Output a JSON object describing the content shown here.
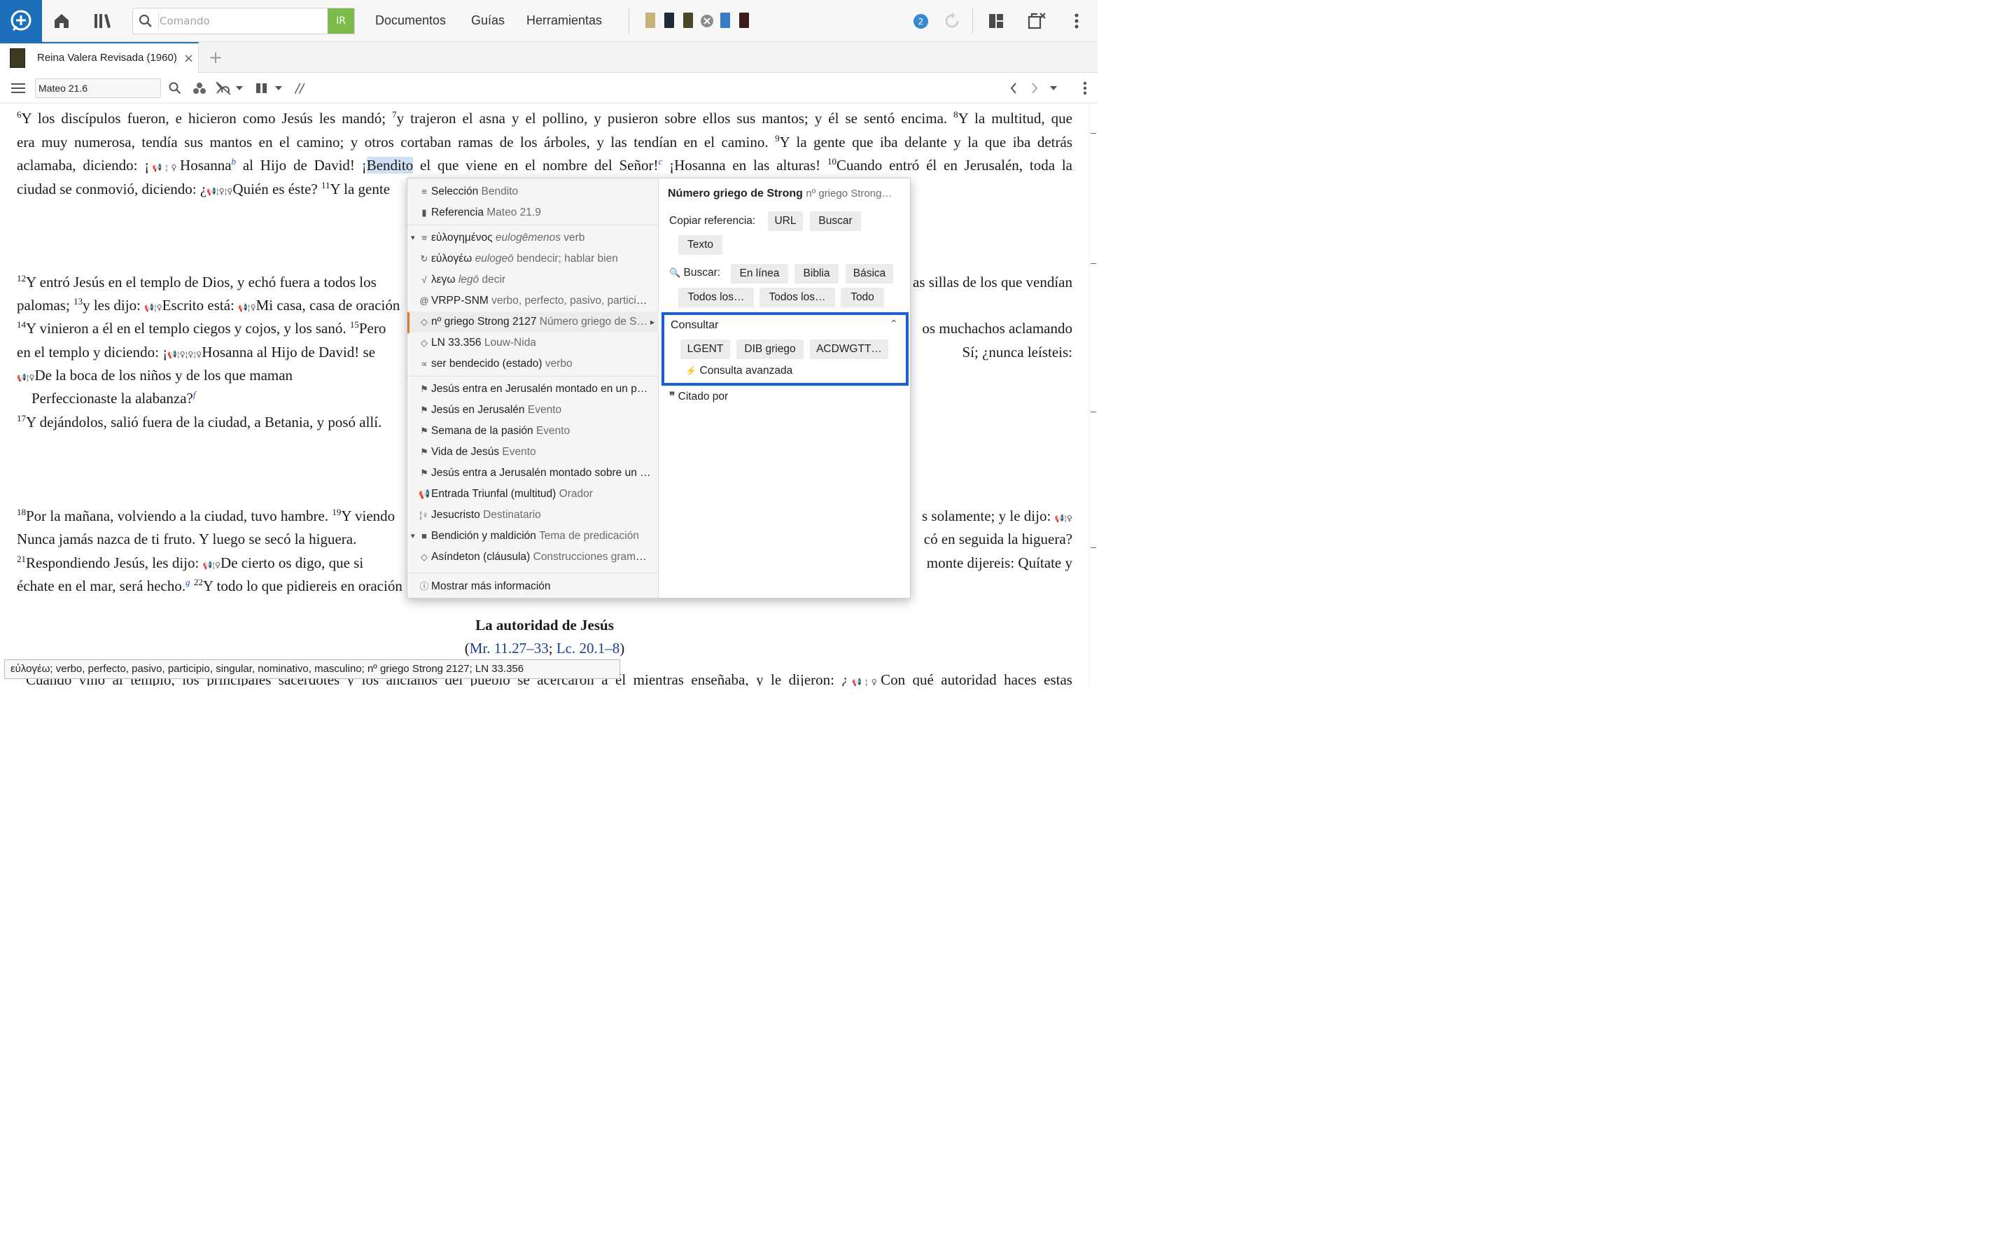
{
  "toolbar": {
    "command_placeholder": "Comando",
    "go_label": "IR",
    "nav": [
      "Documentos",
      "Guías",
      "Herramientas"
    ],
    "notifications": "2"
  },
  "tab": {
    "title": "Reina Valera Revisada (1960)",
    "close": "×",
    "add": "+"
  },
  "panel": {
    "reference": "Mateo 21.6",
    "parallel": "//"
  },
  "text": {
    "lines": [
      {
        "html": "<sup>6</sup>Y los discípulos fueron, e hicieron como Jesús les mandó; <sup>7</sup>y trajeron el asna y el pollino, y pusieron sobre ellos sus mantos; y él se sentó encima. <sup>8</sup>Y la multitud, que"
      },
      {
        "html": "era muy numerosa, tendía sus mantos en el camino; y otros cortaban ramas de los árboles, y las tendían en el camino. <sup>9</sup>Y la gente que iba delante y la que iba detrás"
      },
      {
        "html": "aclamaba, diciendo: ¡<span class=\"sp\">📢¦♀</span>Hosanna<sup class=\"fn\">b</sup> al Hijo de David! ¡<span class=\"hl\">Bendito</span> el que viene en el nombre del Señor!<sup class=\"fn\">c</sup> ¡Hosanna en las alturas! <sup>10</sup>Cuando entró él en Jerusalén, toda la"
      },
      {
        "html": "ciudad se conmovió, diciendo: ¿<span class=\"sp\">📢¦♀¦♀</span>Quién es éste? <sup>11</sup>Y la gente",
        "left": true
      },
      {
        "html": "<sup>12</sup>Y entró Jesús en el templo de Dios, y echó fuera a todos los",
        "right": "as sillas de los que vendían"
      },
      {
        "html": "palomas; <sup>13</sup>y les dijo: <span class=\"sp\">📢¦♀</span>Escrito está: <span class=\"sp\">📢¦♀</span>Mi casa, casa de oración",
        "left": true
      },
      {
        "html": " <sup>14</sup>Y vinieron a él en el templo ciegos y cojos, y los sanó. <sup>15</sup>Pero",
        "right": "os muchachos aclamando"
      },
      {
        "html": "en el templo y diciendo: ¡<span class=\"sp\">📢¦♀¦♀¦♀</span>Hosanna al Hijo de David! se",
        "right": "Sí; ¿nunca leísteis:"
      },
      {
        "html": "<span class=\"sp\">📢¦♀</span>De la boca de los niños y de los que maman",
        "left": true
      },
      {
        "html": "&nbsp;&nbsp;&nbsp;&nbsp;Perfeccionaste la alabanza?<sup class=\"fn\">f</sup>",
        "left": true
      },
      {
        "html": "<sup>17</sup>Y dejándolos, salió fuera de la ciudad, a Betania, y posó allí.",
        "left": true
      },
      {
        "html": " <sup>18</sup>Por la mañana, volviendo a la ciudad, tuvo hambre. <sup>19</sup>Y viendo",
        "right": "s solamente; y le dijo: <span class=\"sp\">📢¦♀</span>"
      },
      {
        "html": "Nunca jamás nazca de ti fruto. Y luego se secó la higuera.",
        "right": "có en seguida la higuera?"
      },
      {
        "html": "<sup>21</sup>Respondiendo Jesús, les dijo: <span class=\"sp\">📢¦♀</span>De cierto os digo, que si",
        "right": "monte dijereis: Quítate y"
      },
      {
        "html": "échate en el mar, será hecho.<sup class=\"fn\">g</sup> <sup>22</sup>Y todo lo que pidiereis en oración",
        "left": true
      }
    ],
    "heading": "La autoridad de Jesús",
    "crossref_open": "(",
    "crossref_1": "Mr. 11.27–33",
    "crossref_sep": "; ",
    "crossref_2": "Lc. 20.1–8",
    "crossref_close": ")",
    "last_line": "<sup>23</sup>Cuando vino al templo, los principales sacerdotes y los ancianos del pueblo se acercaron a él mientras enseñaba, y le dijeron: ¿<span class=\"sp\">📢¦♀</span>Con qué autoridad haces estas"
  },
  "menu": {
    "items": [
      {
        "icon": "≡",
        "label": "Selección",
        "detail": "Bendito"
      },
      {
        "icon": "▮",
        "label": "Referencia",
        "detail": "Mateo 21.9"
      },
      {
        "icon": "≡",
        "label": "εὐλογημένος",
        "italic": "eulogēmenos",
        "detail": "verb",
        "expand": true
      },
      {
        "icon": "↻",
        "label": "εὐλογέω",
        "italic": "eulogeō",
        "detail": "bendecir; hablar bien"
      },
      {
        "icon": "√",
        "label": "λεγω",
        "italic": "legō",
        "detail": "decir"
      },
      {
        "icon": "@",
        "label": "VRPP-SNM",
        "detail": "verbo, perfecto, pasivo, participi…"
      },
      {
        "icon": "◇",
        "label": "nº griego Strong 2127",
        "detail": "Número griego de S…",
        "submenu": true
      },
      {
        "icon": "◇",
        "label": "LN 33.356",
        "detail": "Louw-Nida"
      },
      {
        "icon": "∝",
        "label": "ser bendecido (estado)",
        "detail": "verbo"
      },
      {
        "icon": "⚑",
        "label": "Jesús entra en Jerusalén montado en un po…",
        "detail": ""
      },
      {
        "icon": "⚑",
        "label": "Jesús en Jerusalén",
        "detail": "Evento"
      },
      {
        "icon": "⚑",
        "label": "Semana de la pasión",
        "detail": "Evento"
      },
      {
        "icon": "⚑",
        "label": "Vida de Jesús",
        "detail": "Evento"
      },
      {
        "icon": "⚑",
        "label": "Jesús entra a Jerusalén montado sobre un a…",
        "detail": ""
      },
      {
        "icon": "📢",
        "label": "Entrada Triunfal (multitud)",
        "detail": "Orador"
      },
      {
        "icon": "¦♀",
        "label": "Jesucristo",
        "detail": "Destinatario"
      },
      {
        "icon": "■",
        "label": "Bendición y maldición",
        "detail": "Tema de predicación",
        "expand": true
      },
      {
        "icon": "◇",
        "label": "Asíndeton (cláusula)",
        "detail": "Construcciones gramat…"
      }
    ],
    "more_info": "Mostrar más información"
  },
  "details": {
    "title": "Número griego de Strong",
    "subtitle": "nº griego Strong…",
    "copy_label": "Copiar referencia:",
    "copy_buttons": [
      "URL",
      "Buscar",
      "Texto"
    ],
    "search_label": "Buscar:",
    "search_buttons": [
      "En línea",
      "Biblia",
      "Básica",
      "Todos los…",
      "Todos los…",
      "Todo"
    ],
    "consult_label": "Consultar",
    "consult_buttons": [
      "LGENT",
      "DIB griego",
      "ACDWGTT…"
    ],
    "advanced": "Consulta avanzada",
    "cited_by": "Citado por"
  },
  "status": "εὐλογέω; verbo, perfecto, pasivo, participio, singular, nominativo, masculino; nº griego Strong 2127; LN 33.356",
  "colors": {
    "accent": "#1c6fb8",
    "go": "#7dbb4c",
    "focus": "#1662d4",
    "highlight": "#cfe0f5"
  }
}
